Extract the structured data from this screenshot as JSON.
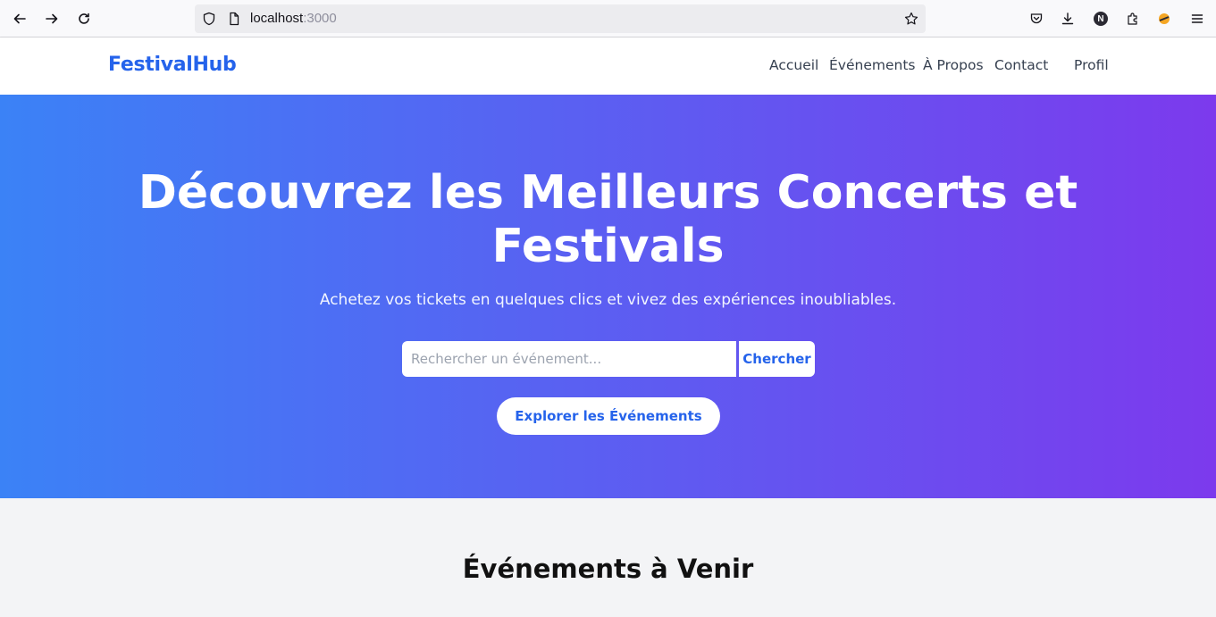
{
  "browser": {
    "url_host": "localhost",
    "url_port": ":3000"
  },
  "header": {
    "logo": "FestivalHub",
    "nav": [
      "Accueil",
      "Événements",
      "À Propos",
      "Contact",
      "Profil"
    ]
  },
  "hero": {
    "title": "Découvrez les Meilleurs Concerts et Festivals",
    "subtitle": "Achetez vos tickets en quelques clics et vivez des expériences inoubliables.",
    "search_placeholder": "Rechercher un événement...",
    "search_button": "Chercher",
    "explore_button": "Explorer les Événements"
  },
  "events_section": {
    "title": "Événements à Venir"
  },
  "colors": {
    "brand": "#2563eb",
    "gradient_start": "#3b82f6",
    "gradient_end": "#7c3aed"
  }
}
